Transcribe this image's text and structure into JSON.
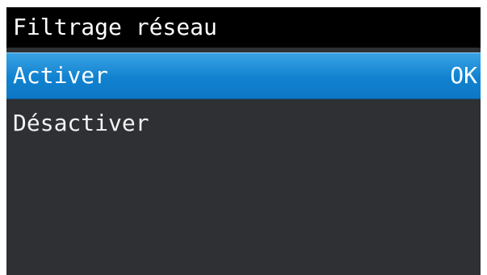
{
  "screen": {
    "title": "Filtrage réseau"
  },
  "menu": {
    "items": [
      {
        "label": "Activer",
        "selected": true,
        "confirm_label": "OK"
      },
      {
        "label": "Désactiver",
        "selected": false
      }
    ]
  },
  "colors": {
    "background": "#2e3034",
    "title_bar": "#000000",
    "selection": "#1182d0",
    "text": "#ffffff"
  }
}
